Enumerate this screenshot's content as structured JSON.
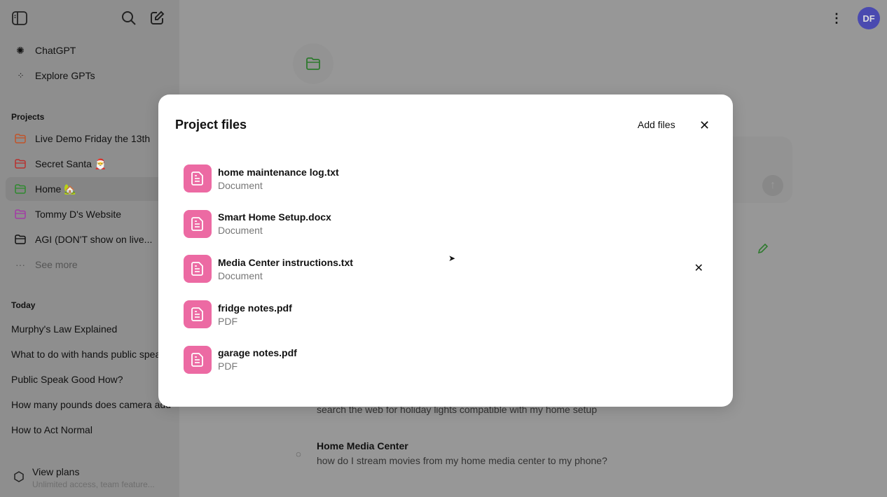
{
  "sidebar": {
    "top_items": [
      {
        "label": "ChatGPT",
        "icon": "chatgpt-logo-icon"
      },
      {
        "label": "Explore GPTs",
        "icon": "grid-icon"
      }
    ],
    "projects_heading": "Projects",
    "projects": [
      {
        "label": "Live Demo Friday the 13th",
        "color": "#c0542a"
      },
      {
        "label": "Secret Santa 🎅",
        "color": "#b8302f"
      },
      {
        "label": "Home 🏡",
        "color": "#2e8a2e",
        "selected": true
      },
      {
        "label": "Tommy D's Website",
        "color": "#a33aa6"
      },
      {
        "label": "AGI (DON'T show on live...",
        "color": "#111111"
      }
    ],
    "see_more": "See more",
    "today_heading": "Today",
    "history": [
      "Murphy's Law Explained",
      "What to do with hands public speaking",
      "Public Speak Good How?",
      "How many pounds does camera add",
      "How to Act Normal"
    ],
    "plans_title": "View plans",
    "plans_subtitle": "Unlimited access, team feature..."
  },
  "header": {
    "avatar_initials": "DF"
  },
  "background_chats": [
    {
      "subtitle": "search the web for holiday lights compatible with my home setup"
    },
    {
      "title": "Home Media Center",
      "subtitle": "how do I stream movies from my home media center to my phone?"
    }
  ],
  "modal": {
    "title": "Project files",
    "add_files": "Add files",
    "files": [
      {
        "name": "home maintenance log.txt",
        "type": "Document"
      },
      {
        "name": "Smart Home Setup.docx",
        "type": "Document"
      },
      {
        "name": "Media Center instructions.txt",
        "type": "Document",
        "hovered": true
      },
      {
        "name": "fridge notes.pdf",
        "type": "PDF"
      },
      {
        "name": "garage notes.pdf",
        "type": "PDF"
      }
    ],
    "file_icon_color": "#ec6aa3"
  }
}
